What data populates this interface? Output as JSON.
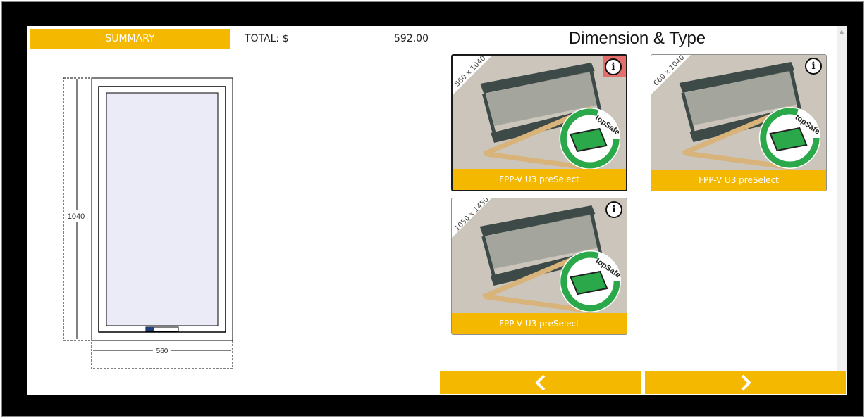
{
  "summary": {
    "label": "SUMMARY"
  },
  "total": {
    "label": "TOTAL: $",
    "value": "592.00"
  },
  "drawing": {
    "height_label": "1040",
    "width_label": "560"
  },
  "section_title": "Dimension & Type",
  "products": [
    {
      "size": "560 x 1040",
      "name": "FPP-V U3 preSelect",
      "selected": true,
      "info_highlighted": true
    },
    {
      "size": "660 x 1040",
      "name": "FPP-V U3 preSelect",
      "selected": false,
      "info_highlighted": false
    },
    {
      "size": "1050 x 1450",
      "name": "FPP-V U3 preSelect",
      "selected": false,
      "info_highlighted": false
    }
  ],
  "badge": {
    "text": "topSafe"
  },
  "info_icon_glyph": "i",
  "nav": {
    "prev_icon": "chevron-left-icon",
    "next_icon": "chevron-right-icon"
  },
  "colors": {
    "accent": "#f5b800",
    "frame": "#000000",
    "badge_green": "#2aa84a"
  }
}
